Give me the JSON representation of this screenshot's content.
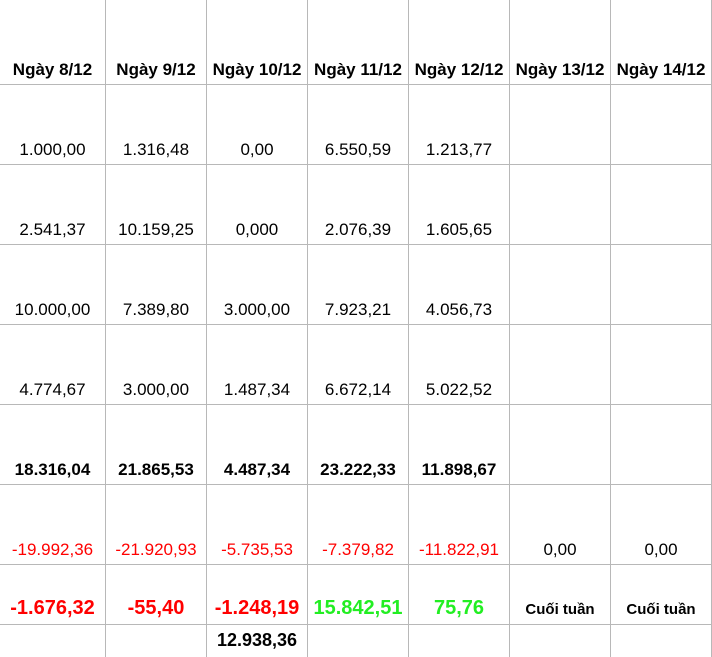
{
  "headers": [
    "Ngày 8/12",
    "Ngày 9/12",
    "Ngày 10/12",
    "Ngày 11/12",
    "Ngày 12/12",
    "Ngày 13/12",
    "Ngày 14/12"
  ],
  "rows": [
    {
      "style": "plain",
      "values": [
        "1.000,00",
        "1.316,48",
        "0,00",
        "6.550,59",
        "1.213,77",
        "",
        ""
      ]
    },
    {
      "style": "plain",
      "values": [
        "2.541,37",
        "10.159,25",
        "0,000",
        "2.076,39",
        "1.605,65",
        "",
        ""
      ]
    },
    {
      "style": "plain",
      "values": [
        "10.000,00",
        "7.389,80",
        "3.000,00",
        "7.923,21",
        "4.056,73",
        "",
        ""
      ]
    },
    {
      "style": "plain",
      "values": [
        "4.774,67",
        "3.000,00",
        "1.487,34",
        "6.672,14",
        "5.022,52",
        "",
        ""
      ]
    },
    {
      "style": "bold",
      "values": [
        "18.316,04",
        "21.865,53",
        "4.487,34",
        "23.222,33",
        "11.898,67",
        "",
        ""
      ]
    },
    {
      "style": "red",
      "values": [
        "-19.992,36",
        "-21.920,93",
        "-5.735,53",
        "-7.379,82",
        "-11.822,91",
        "0,00",
        "0,00"
      ]
    }
  ],
  "result_row": {
    "values": [
      "-1.676,32",
      "-55,40",
      "-1.248,19",
      "15.842,51",
      "75,76"
    ],
    "signs": [
      "neg",
      "neg",
      "neg",
      "pos",
      "pos"
    ],
    "weekend_labels": [
      "Cuối tuần",
      "Cuối tuần"
    ]
  },
  "total": "12.938,36",
  "colors": {
    "negative": "#ff0000",
    "positive": "#22ee22",
    "grid": "#b8b8b8"
  }
}
